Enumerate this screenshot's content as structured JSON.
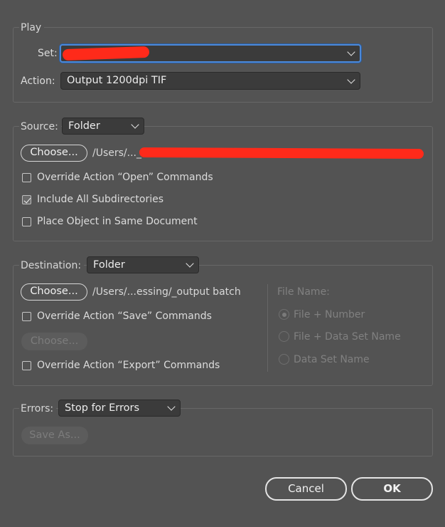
{
  "play": {
    "legend": "Play",
    "set_label": "Set:",
    "set_value": "",
    "action_label": "Action:",
    "action_value": "Output 1200dpi TIF"
  },
  "source": {
    "legend": "Source:",
    "type_value": "Folder",
    "choose_label": "Choose...",
    "path": "/Users/..._",
    "options": [
      {
        "label": "Override Action “Open” Commands",
        "checked": false
      },
      {
        "label": "Include All Subdirectories",
        "checked": true
      },
      {
        "label": "Place Object in Same Document",
        "checked": false
      }
    ]
  },
  "destination": {
    "legend": "Destination:",
    "type_value": "Folder",
    "choose_label": "Choose...",
    "path": "/Users/...essing/_output batch",
    "override_save": {
      "label": "Override Action “Save” Commands",
      "checked": false
    },
    "choose_disabled_label": "Choose...",
    "override_export": {
      "label": "Override Action “Export” Commands",
      "checked": false
    },
    "file_name": {
      "label": "File Name:",
      "options": [
        {
          "label": "File + Number",
          "selected": true
        },
        {
          "label": "File + Data Set Name",
          "selected": false
        },
        {
          "label": "Data Set Name",
          "selected": false
        }
      ]
    }
  },
  "errors": {
    "label": "Errors:",
    "value": "Stop for Errors",
    "save_as_label": "Save As..."
  },
  "footer": {
    "cancel_label": "Cancel",
    "ok_label": "OK"
  },
  "colors": {
    "background": "#535353",
    "focus_ring": "#4c89d8",
    "redaction": "#ff2a1a"
  }
}
